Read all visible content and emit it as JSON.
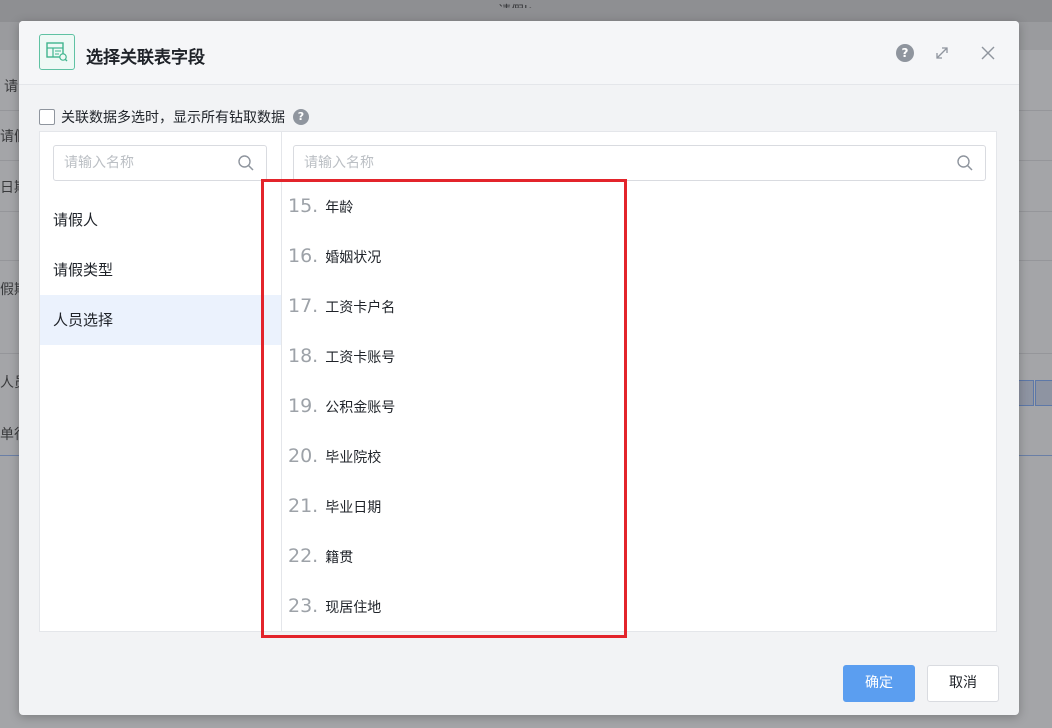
{
  "background": {
    "top_title": "请假k",
    "side_labels": [
      "请",
      "请假",
      "日期",
      "假期",
      "人员",
      "单行"
    ]
  },
  "dialog": {
    "title": "选择关联表字段",
    "help_glyph": "?",
    "multi_select": {
      "label": "关联数据多选时，显示所有钻取数据",
      "checked": false,
      "help_glyph": "?"
    },
    "left_panel": {
      "search_placeholder": "请输入名称",
      "items": [
        {
          "label": "请假人",
          "active": false
        },
        {
          "label": "请假类型",
          "active": false
        },
        {
          "label": "人员选择",
          "active": true
        }
      ]
    },
    "right_panel": {
      "search_placeholder": "请输入名称",
      "fields": [
        {
          "num": "15.",
          "label": "年龄"
        },
        {
          "num": "16.",
          "label": "婚姻状况"
        },
        {
          "num": "17.",
          "label": "工资卡户名"
        },
        {
          "num": "18.",
          "label": "工资卡账号"
        },
        {
          "num": "19.",
          "label": "公积金账号"
        },
        {
          "num": "20.",
          "label": "毕业院校"
        },
        {
          "num": "21.",
          "label": "毕业日期"
        },
        {
          "num": "22.",
          "label": "籍贯"
        },
        {
          "num": "23.",
          "label": "现居住地"
        }
      ]
    },
    "footer": {
      "confirm_label": "确定",
      "cancel_label": "取消"
    }
  },
  "colors": {
    "primary": "#5b9ef0",
    "active_item_bg": "#ebf2fd",
    "highlight": "#e3242b",
    "icon_green": "#3fb58e"
  }
}
